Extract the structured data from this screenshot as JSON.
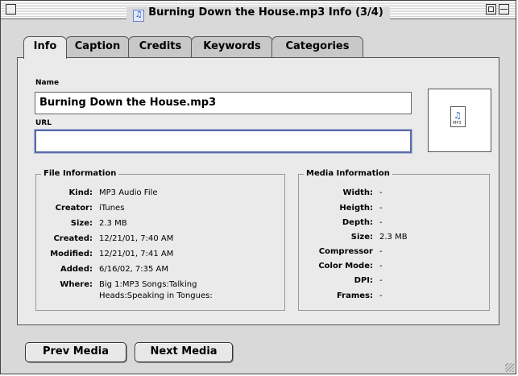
{
  "window": {
    "title": "Burning Down the House.mp3 Info (3/4)",
    "title_icon": "music-note-icon"
  },
  "tabs": [
    {
      "label": "Info",
      "active": true
    },
    {
      "label": "Caption",
      "active": false
    },
    {
      "label": "Credits",
      "active": false
    },
    {
      "label": "Keywords",
      "active": false
    },
    {
      "label": "Categories",
      "active": false
    }
  ],
  "fields": {
    "name_label": "Name",
    "name_value": "Burning Down the House.mp3",
    "url_label": "URL",
    "url_value": ""
  },
  "thumbnail": {
    "icon": "mp3-document-icon",
    "glyph": "♫",
    "ext": "MP3"
  },
  "file_info": {
    "title": "File Information",
    "rows": [
      {
        "key": "Kind:",
        "value": "MP3 Audio File"
      },
      {
        "key": "Creator:",
        "value": "iTunes"
      },
      {
        "key": "Size:",
        "value": "2.3 MB"
      },
      {
        "key": "Created:",
        "value": "12/21/01, 7:40 AM"
      },
      {
        "key": "Modified:",
        "value": "12/21/01, 7:41 AM"
      },
      {
        "key": "Added:",
        "value": "6/16/02, 7:35 AM"
      },
      {
        "key": "Where:",
        "value": "Big 1:MP3 Songs:Talking",
        "value2": "Heads:Speaking in Tongues:"
      }
    ]
  },
  "media_info": {
    "title": "Media Information",
    "rows": [
      {
        "key": "Width:",
        "value": "-"
      },
      {
        "key": "Heigth:",
        "value": "-"
      },
      {
        "key": "Depth:",
        "value": "-"
      },
      {
        "key": "Size:",
        "value": "2.3 MB"
      },
      {
        "key": "Compressor",
        "value": "-"
      },
      {
        "key": "Color Mode:",
        "value": "-"
      },
      {
        "key": "DPI:",
        "value": "-"
      },
      {
        "key": "Frames:",
        "value": "-"
      }
    ]
  },
  "buttons": {
    "prev": "Prev Media",
    "next": "Next Media"
  }
}
